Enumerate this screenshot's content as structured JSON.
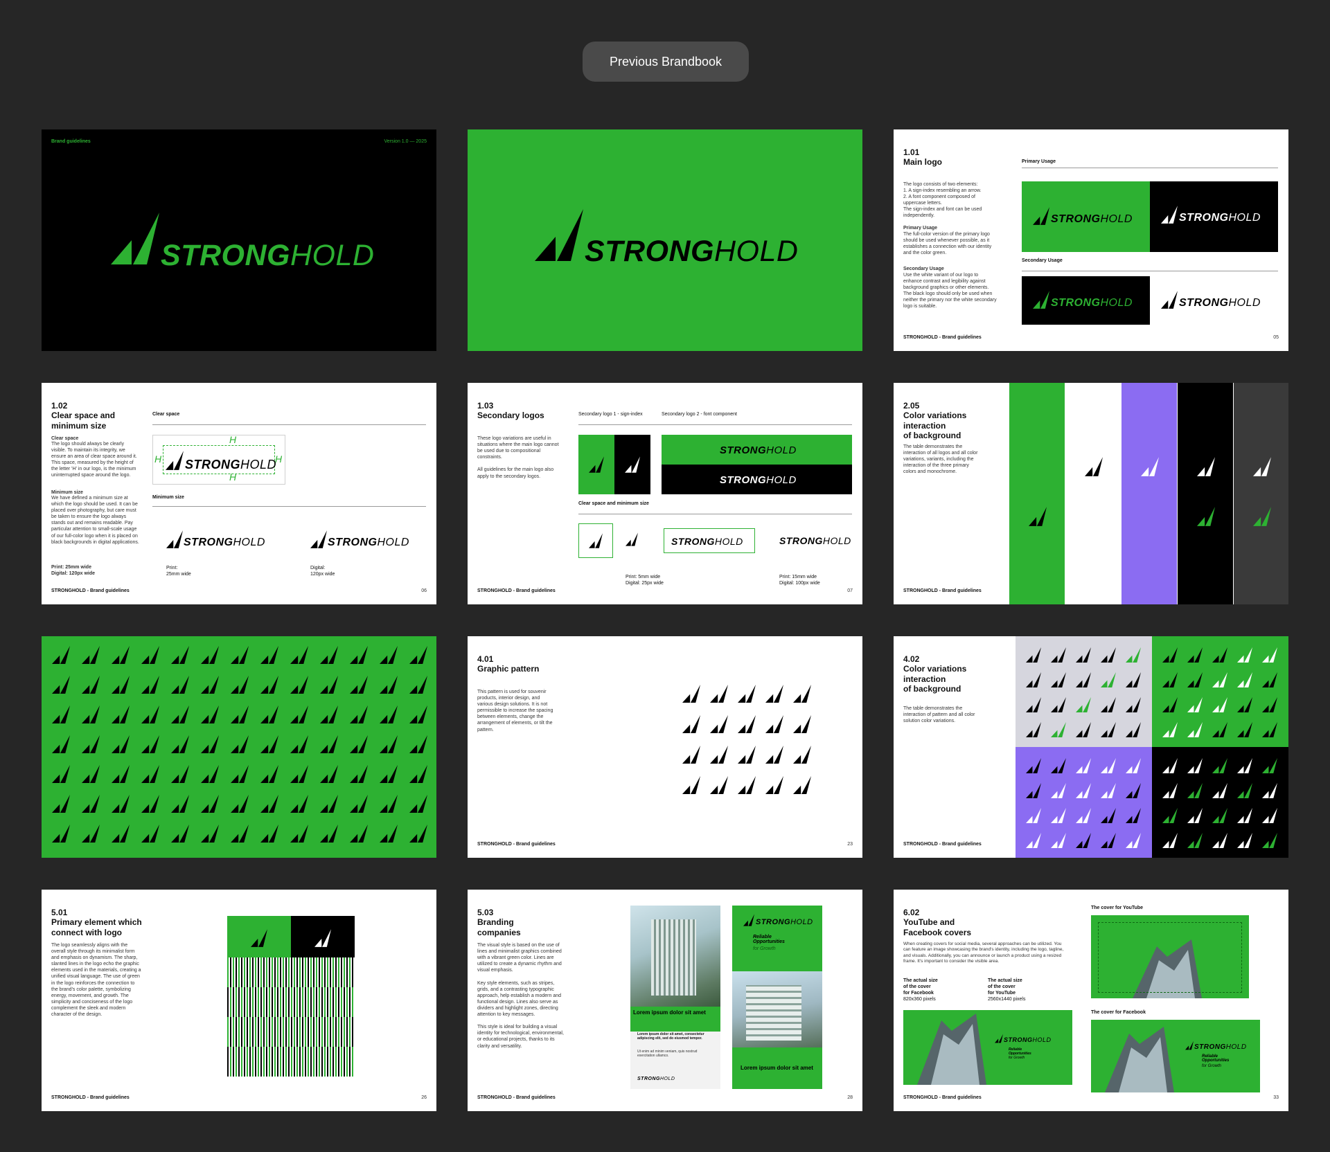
{
  "header": {
    "button_label": "Previous Brandbook"
  },
  "brand": {
    "wordmark_bold": "STRONG",
    "wordmark_light": "HOLD",
    "green": "#2db132",
    "purple": "#8b6cf2",
    "black": "#000000",
    "gray": "#3a3a3a"
  },
  "s1": {
    "top_left": "Brand guidelines",
    "top_right": "Version 1.0 — 2025"
  },
  "footer_text": "STRONGHOLD - Brand guidelines",
  "s3": {
    "num": "1.01",
    "title": "Main logo",
    "body1": "The logo consists of two elements:\n1. A sign-index resembling an arrow.\n2. A font component composed of uppercase letters.\nThe sign-index and font can be used independently.",
    "h2": "Primary Usage",
    "body2": "The full-color version of the primary logo should be used whenever possible, as it establishes a connection with our identity and the color green.",
    "h3": "Secondary Usage",
    "body3": "Use the white variant of our logo to enhance contrast and legibility against background graphics or other elements. The black logo should only be used when neither the primary nor the white secondary logo is suitable.",
    "label_primary": "Primary Usage",
    "label_secondary": "Secondary Usage",
    "page": "05"
  },
  "s4": {
    "num": "1.02",
    "title": "Clear space and\nminimum size",
    "h1": "Clear space",
    "body1": "The logo should always be clearly visible. To maintain its integrity, we ensure an area of clear space around it. This space, measured by the height of the letter 'H' in our logo, is the minimum uninterrupted space around the logo.",
    "h2": "Minimum size",
    "body2": "We have defined a minimum size at which the logo should be used. It can be placed over photography, but care must be taken to ensure the logo always stands out and remains readable. Pay particular attention to small-scale usage of our full-color logo when it is placed on black backgrounds in digital applications.",
    "sizes": "Print:     25mm wide\nDigital:   120px wide",
    "label_clear": "Clear space",
    "label_min": "Minimum size",
    "h_mark": "H",
    "print": "Print:\n25mm wide",
    "digital": "Digital:\n120px wide",
    "page": "06"
  },
  "s5": {
    "num": "1.03",
    "title": "Secondary logos",
    "body": "These logo variations are useful in situations where the main logo cannot be used due to compositional constraints.\n\nAll guidelines for the main logo also apply to the secondary logos.",
    "label1": "Secondary logo 1 - sign-index",
    "label2": "Secondary logo 2 - font component",
    "label3": "Clear space and minimum size",
    "size1": "Print: 5mm wide\nDigital: 25px wide",
    "size2": "Print: 15mm wide\nDigital: 100px wide",
    "page": "07"
  },
  "s6": {
    "num": "2.05",
    "title": "Color variations\ninteraction\nof background",
    "body": "The table demonstrates the interaction of all logos and all color variations, variants, including the interaction of the three primary colors and monochrome."
  },
  "s8": {
    "num": "4.01",
    "title": "Graphic pattern",
    "body": "This pattern is used for souvenir products, interior design, and various design solutions. It is not permissible to increase the spacing between elements, change the arrangement of elements, or tilt the pattern.",
    "page": "23"
  },
  "s9": {
    "num": "4.02",
    "title": "Color variations\ninteraction\nof background",
    "body": "The table demonstrates the interaction of pattern and all color solution color variations."
  },
  "s10": {
    "num": "5.01",
    "title": "Primary element which\nconnect with logo",
    "body": "The logo seamlessly aligns with the overall style through its minimalist form and emphasis on dynamism. The sharp, slanted lines in the logo echo the graphic elements used in the materials, creating a unified visual language. The use of green in the logo reinforces the connection to the brand's color palette, symbolizing energy, movement, and growth. The simplicity and conciseness of the logo complement the sleek and modern character of the design.",
    "page": "26"
  },
  "s11": {
    "num": "5.03",
    "title": "Branding\ncompanies",
    "body": "The visual style is based on the use of lines and minimalist graphics combined with a vibrant green color. Lines are utilized to create a dynamic rhythm and visual emphasis.\n\nKey style elements, such as stripes, grids, and a contrasting typographic approach, help establish a modern and functional design. Lines also serve as dividers and highlight zones, directing attention to key messages.\n\nThis style is ideal for building a visual identity for technological, environmental, or educational projects, thanks to its clarity and versatility.",
    "poster1_title": "Lorem ipsum dolor sit amet",
    "poster1_body": "Lorem ipsum dolor sit amet, consectetur adipiscing elit, sed do eiusmod tempor.",
    "poster1_small": "Ut enim ad minim veniam, quis nostrud exercitation ullamco.",
    "poster2_tag": "Reliable\nOpportunities",
    "poster2_tag2": "for Growth",
    "poster2_title": "Lorem ipsum dolor sit amet",
    "page": "28"
  },
  "s12": {
    "num": "6.02",
    "title": "YouTube and\nFacebook covers",
    "body": "When creating covers for social media, several approaches can be utilized. You can feature an image showcasing the brand's identity, including the logo, tagline, and visuals. Additionally, you can announce or launch a product using a resized frame. It's important to consider the visible area.",
    "fb_label": "The actual size\nof the cover\nfor Facebook",
    "fb_size": "820x360 pixels",
    "yt_label": "The actual size\nof the cover\nfor YouTube",
    "yt_size": "2560x1440 pixels",
    "label_yt": "The cover for YouTube",
    "label_fb": "The cover for Facebook",
    "tagline": "Reliable\nOpportunities",
    "tagline2": "for Growth",
    "page": "33"
  }
}
